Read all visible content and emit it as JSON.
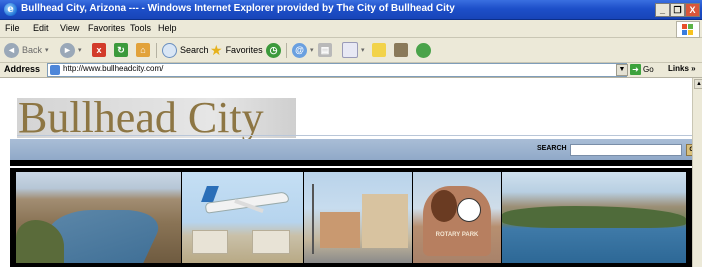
{
  "window": {
    "title": "Bullhead City, Arizona --- - Windows Internet Explorer provided by The City of Bullhead City",
    "controls": [
      "_",
      "❐",
      "X"
    ]
  },
  "menubar": {
    "items": [
      "File",
      "Edit",
      "View",
      "Favorites",
      "Tools",
      "Help"
    ]
  },
  "toolbar": {
    "back_label": "Back",
    "search_label": "Search",
    "favorites_label": "Favorites"
  },
  "addressbar": {
    "label": "Address",
    "url": "http://www.bullheadcity.com/",
    "go_label": "Go",
    "links_label": "Links",
    "links_chevron": "»"
  },
  "page": {
    "logo_text": "Bullhead City",
    "search_label": "SEARCH",
    "search_button": "GO",
    "photo_sign_text": "ROTARY PARK"
  },
  "colors": {
    "titlebar": "#1d4fc9",
    "chrome": "#ece9d8",
    "logo_text": "#8d7644",
    "search_strip": "#a9bdd6"
  }
}
